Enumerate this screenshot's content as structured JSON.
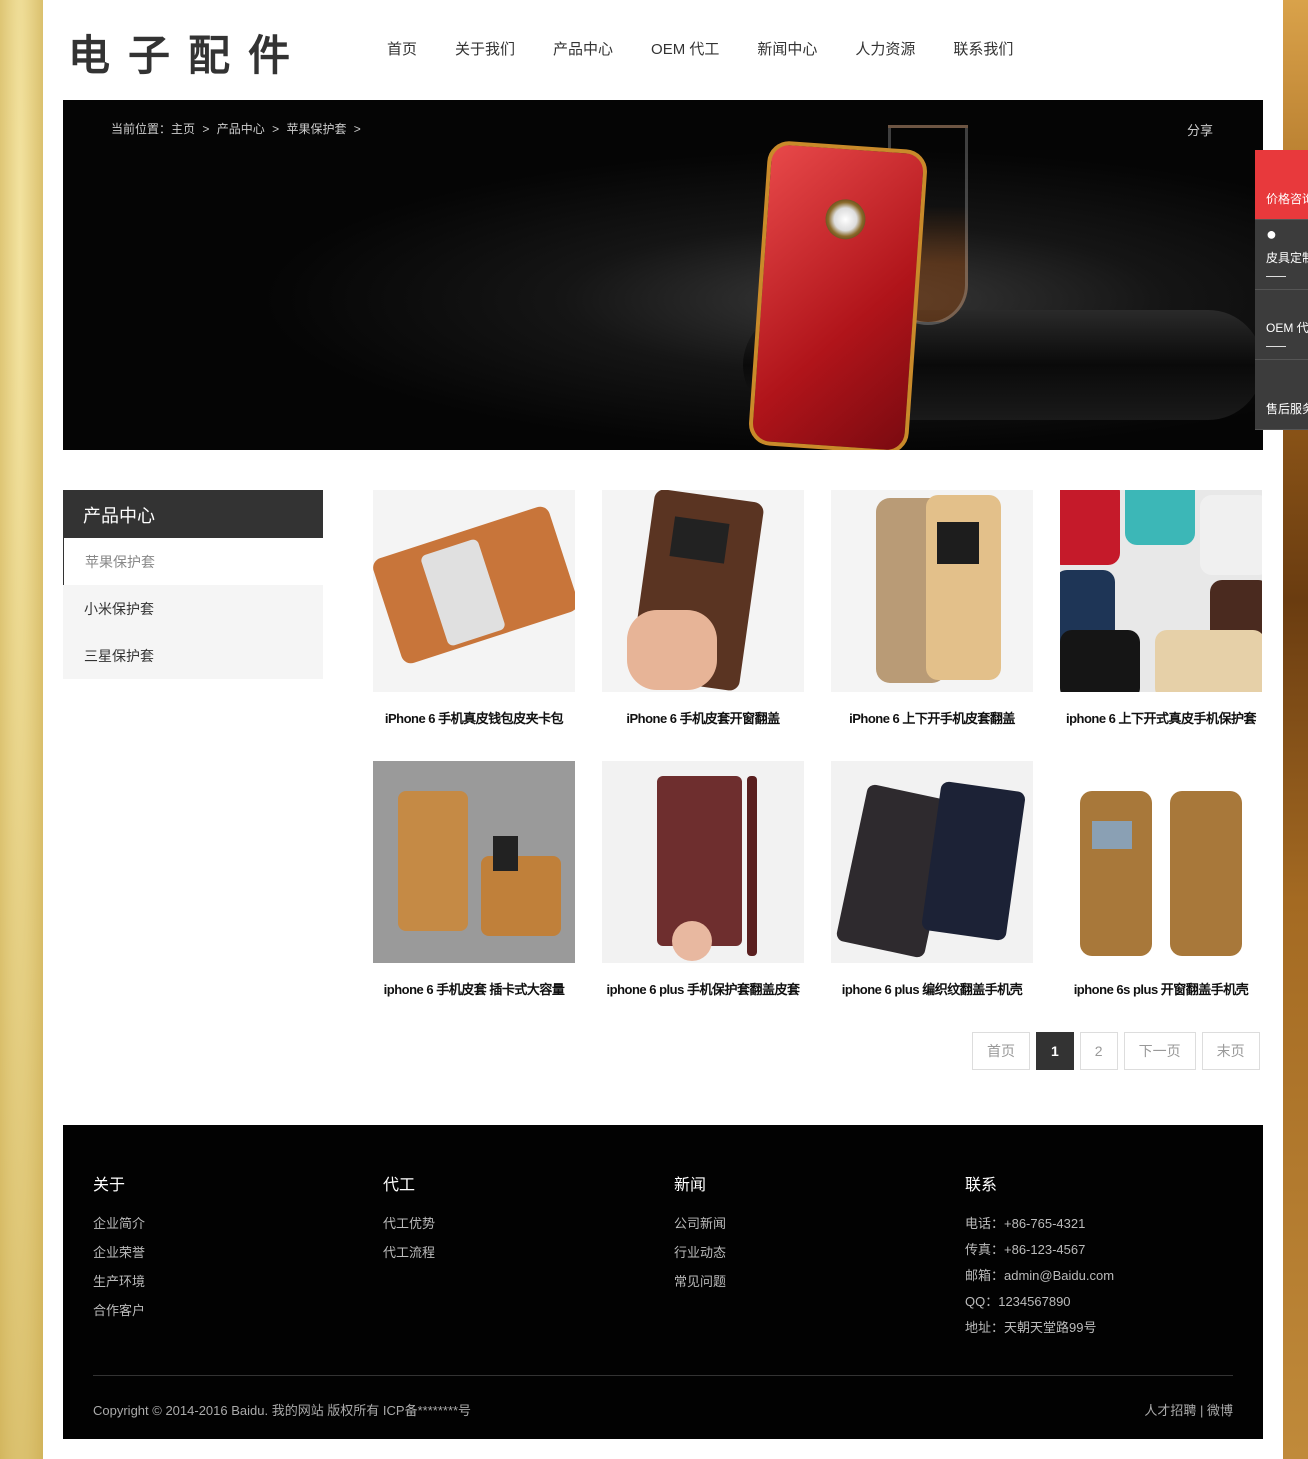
{
  "site": {
    "logo": "电子配件"
  },
  "nav": [
    "首页",
    "关于我们",
    "产品中心",
    "OEM 代工",
    "新闻中心",
    "人力资源",
    "联系我们"
  ],
  "banner": {
    "crumb": [
      "当前位置：主页",
      ">",
      "产品中心",
      ">",
      "苹果保护套",
      ">"
    ],
    "share": "分享"
  },
  "sidebar": {
    "title": "产品中心",
    "items": [
      "苹果保护套",
      "小米保护套",
      "三星保护套"
    ]
  },
  "products": [
    "iPhone 6 手机真皮钱包皮夹卡包",
    "iPhone 6 手机皮套开窗翻盖",
    "iPhone 6 上下开手机皮套翻盖",
    "iphone 6 上下开式真皮手机保护套",
    "iphone 6 手机皮套 插卡式大容量",
    "iphone 6 plus 手机保护套翻盖皮套",
    "iphone 6 plus 编织纹翻盖手机壳",
    "iphone 6s plus 开窗翻盖手机壳"
  ],
  "pager": {
    "first": "首页",
    "pages": [
      "1",
      "2"
    ],
    "next": "下一页",
    "last": "末页"
  },
  "footer": {
    "cols": [
      {
        "title": "关于",
        "links": [
          "企业简介",
          "企业荣誉",
          "生产环境",
          "合作客户"
        ]
      },
      {
        "title": "代工",
        "links": [
          "代工优势",
          "代工流程"
        ]
      },
      {
        "title": "新闻",
        "links": [
          "公司新闻",
          "行业动态",
          "常见问题"
        ]
      }
    ],
    "contact": {
      "title": "联系",
      "lines": [
        "电话：+86-765-4321",
        "传真：+86-123-4567",
        "邮箱：admin@Baidu.com",
        "QQ：1234567890",
        "地址：天朝天堂路99号"
      ]
    },
    "copyright": "Copyright © 2014-2016 Baidu. 我的网站 版权所有  ICP备********号",
    "links": "人才招聘  |   微博"
  },
  "float": [
    "价格咨询",
    "皮具定制",
    "OEM 代工",
    "售后服务"
  ],
  "colors": {
    "accent": "#e8393c",
    "dark": "#333333",
    "footer": "#020202"
  }
}
